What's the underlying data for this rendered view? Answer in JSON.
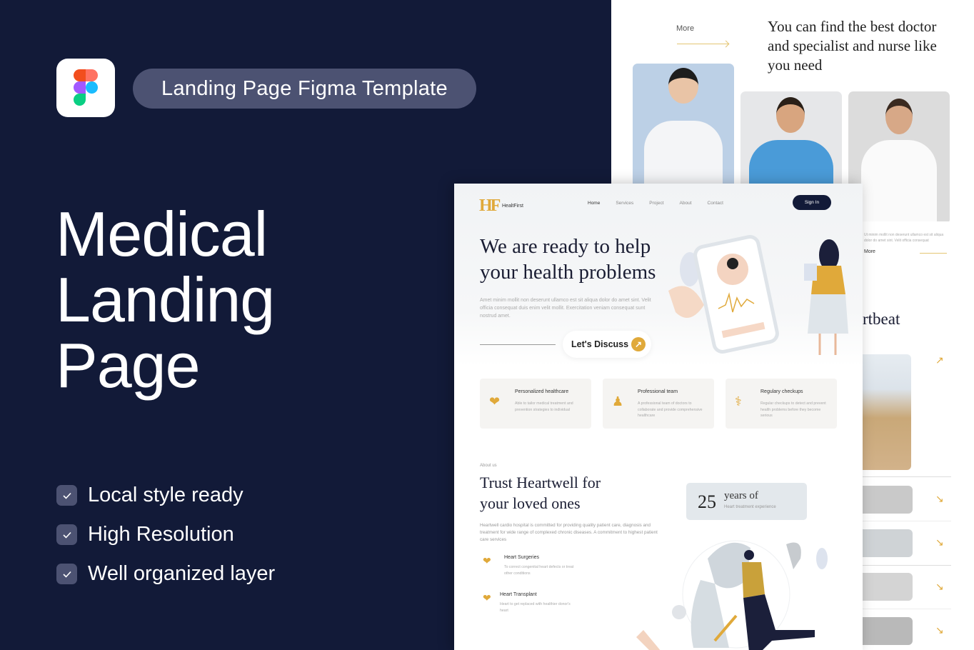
{
  "promo": {
    "tag": "Landing Page Figma Template",
    "title_lines": [
      "Medical",
      "Landing",
      "Page"
    ],
    "features": [
      "Local style ready",
      "High Resolution",
      "Well organized layer"
    ],
    "logo_icon": "figma-logo-icon",
    "check_icon": "checkmark-icon"
  },
  "doctors_section": {
    "more_label": "More",
    "title": "You can find the best doctor and specialist and nurse like you need",
    "side_text": "Ut minim mollit non deserunt ullamco est sit aliqua dolor do amet sint. Velit officia consequat",
    "side_more": "More",
    "heartbeat_partial": "rtbeat"
  },
  "mockup": {
    "brand": {
      "logo": "HF",
      "name": "HealtFirst"
    },
    "nav": [
      "Home",
      "Services",
      "Project",
      "About",
      "Contact"
    ],
    "signin": "Sign In",
    "hero": {
      "title": "We are ready to help your health problems",
      "paragraph": "Amet minim mollit non deserunt ullamco est sit aliqua dolor do amet sint. Velit officia consequat duis enim velit mollit. Exercitation veniam consequat sunt nostrud amet.",
      "cta": "Let's Discuss"
    },
    "services": [
      {
        "title": "Personalized healthcare",
        "desc": "Able to tailor medical treatment and prevention strategies to individual",
        "icon": "heart-hand-icon"
      },
      {
        "title": "Professional team",
        "desc": "A professional team of doctors to collaborate and provide comprehensive healthcare",
        "icon": "nurse-icon"
      },
      {
        "title": "Regulary checkups",
        "desc": "Regular checkups to detect and prevent health problems before they become serious",
        "icon": "doctor-icon"
      }
    ],
    "about": {
      "label": "About us",
      "title": "Trust Heartwell for your loved ones",
      "paragraph": "Heartwell cardio hospital is committed for providing quality patient care, diagnosis and treatment for wide range of complexed chronic diseases. A commitment to highest patient care services",
      "years_number": "25",
      "years_label": "years of",
      "years_sub": "Heart treatment experience",
      "items": [
        {
          "title": "Heart Surgeries",
          "desc": "To correct congenital heart defects or treat other conditions"
        },
        {
          "title": "Heart Transplant",
          "desc": "Heart to get replaced with healthier donor's heart"
        }
      ]
    }
  },
  "colors": {
    "navy": "#121a38",
    "gold": "#e0a93a",
    "pill": "#4c5272"
  }
}
